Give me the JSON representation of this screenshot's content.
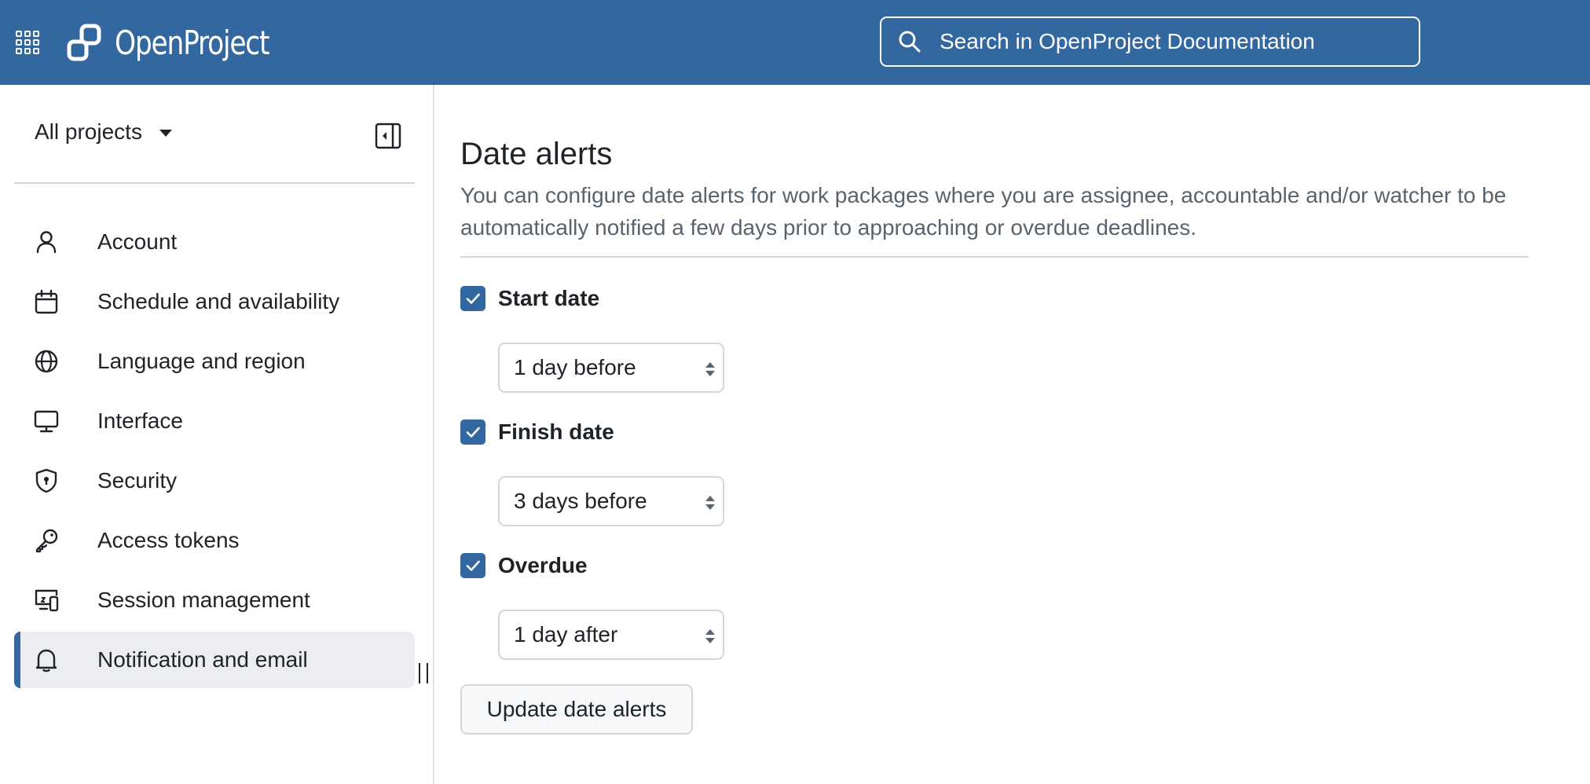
{
  "header": {
    "app_name": "OpenProject",
    "search_placeholder": "Search in OpenProject Documentation",
    "accent_color": "#33679f"
  },
  "sidebar": {
    "project_selector_label": "All projects",
    "items": [
      {
        "label": "Account",
        "icon": "user-icon",
        "active": false
      },
      {
        "label": "Schedule and availability",
        "icon": "calendar-icon",
        "active": false
      },
      {
        "label": "Language and region",
        "icon": "globe-icon",
        "active": false
      },
      {
        "label": "Interface",
        "icon": "monitor-icon",
        "active": false
      },
      {
        "label": "Security",
        "icon": "shield-icon",
        "active": false
      },
      {
        "label": "Access tokens",
        "icon": "key-icon",
        "active": false
      },
      {
        "label": "Session management",
        "icon": "devices-icon",
        "active": false
      },
      {
        "label": "Notification and email",
        "icon": "bell-icon",
        "active": true
      }
    ]
  },
  "main": {
    "title": "Date alerts",
    "description": "You can configure date alerts for work packages where you are assignee, accountable and/or watcher to be automatically notified a few days prior to approaching or overdue deadlines.",
    "alerts": [
      {
        "label": "Start date",
        "checked": true,
        "selected": "1 day before"
      },
      {
        "label": "Finish date",
        "checked": true,
        "selected": "3 days before"
      },
      {
        "label": "Overdue",
        "checked": true,
        "selected": "1 day after"
      }
    ],
    "update_button_label": "Update date alerts"
  }
}
